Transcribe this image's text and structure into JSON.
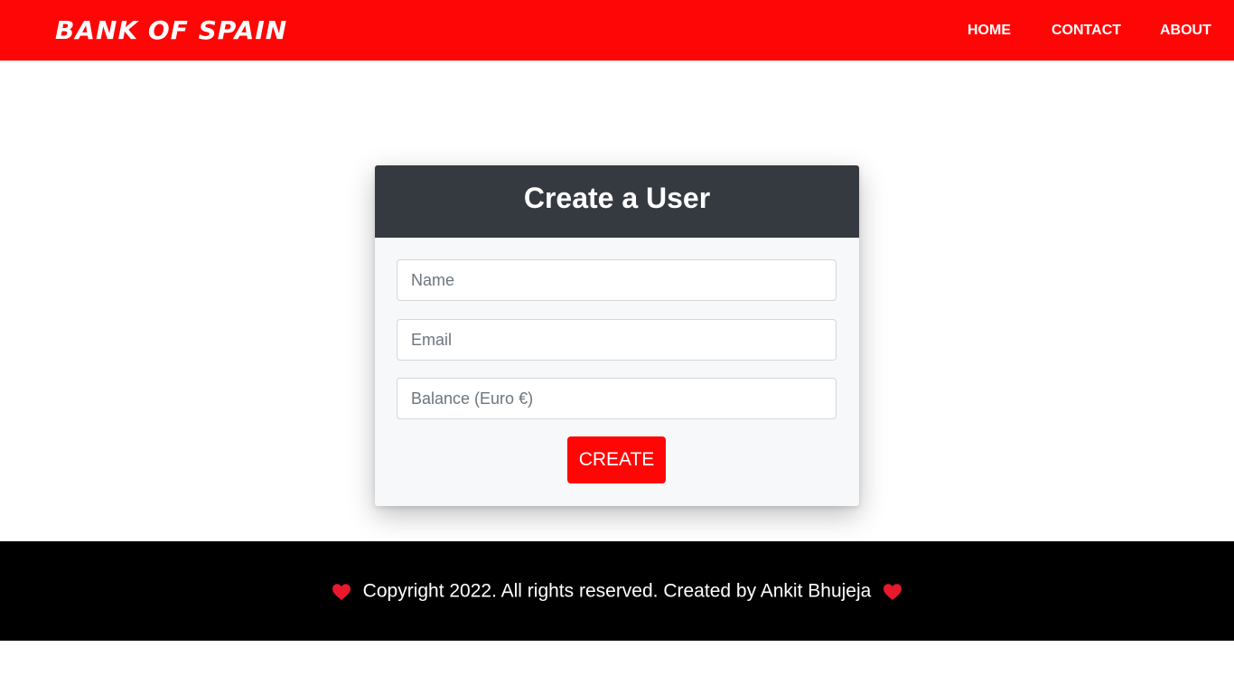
{
  "navbar": {
    "brand": "BANK OF SPAIN",
    "links": [
      "HOME",
      "CONTACT",
      "ABOUT"
    ]
  },
  "form": {
    "title": "Create a User",
    "name_placeholder": "Name",
    "email_placeholder": "Email",
    "balance_placeholder": "Balance (Euro €)",
    "submit_label": "CREATE"
  },
  "footer": {
    "text": "Copyright 2022. All rights reserved. Created by Ankit Bhujeja",
    "icon": "heart-icon"
  },
  "colors": {
    "accent": "#ff0606",
    "header_dark": "#353a41",
    "footer_bg": "#000000",
    "heart": "#e8192c"
  }
}
